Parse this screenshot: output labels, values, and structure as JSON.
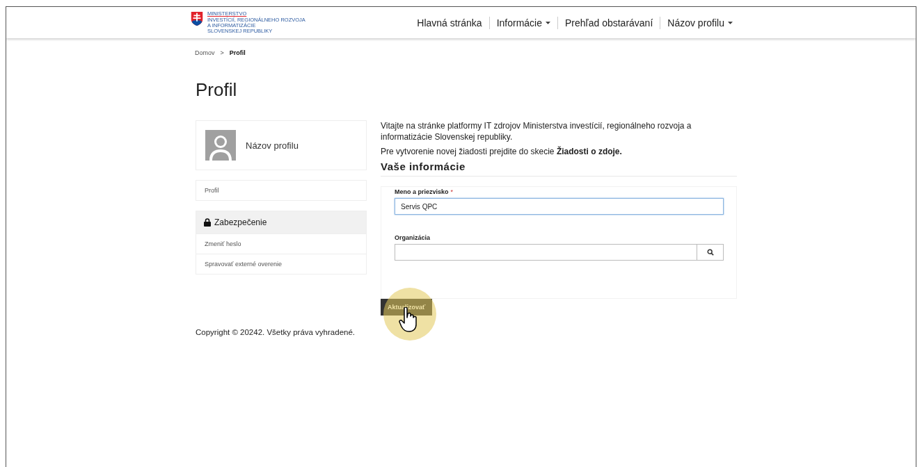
{
  "logo": {
    "lines": [
      "MINISTERSTVO",
      "INVESTÍCIÍ, REGIONÁLNEHO ROZVOJA",
      "A INFORMATIZÁCIE",
      "SLOVENSKEJ REPUBLIKY"
    ]
  },
  "nav": [
    {
      "label": "Hlavná stránka",
      "dropdown": false
    },
    {
      "label": "Informácie",
      "dropdown": true
    },
    {
      "label": "Prehľad obstarávaní",
      "dropdown": false
    },
    {
      "label": "Názov profilu",
      "dropdown": true
    }
  ],
  "breadcrumb": [
    {
      "label": "Domov",
      "selected": false
    },
    {
      "label": "Profil",
      "selected": true
    }
  ],
  "breadcrumb_separator": ">",
  "page_title": "Profil",
  "profile_card": {
    "name": "Názov profilu"
  },
  "sidebar": {
    "items": [
      {
        "label": "Profil"
      }
    ],
    "section": {
      "title": "Zabezpečenie",
      "items": [
        {
          "label": "Zmeniť heslo"
        },
        {
          "label": "Spravovať externé overenie"
        }
      ]
    }
  },
  "intro": [
    "Vitajte na stránke platformy IT zdrojov Ministerstva investícií, regionálneho rozvoja a informatizácie Slovenskej republiky.",
    "Pre vytvorenie novej žiadosti prejdite do skecie **Žiadosti o zdoje.**"
  ],
  "section_title": "Vaše informácie",
  "form": {
    "fields": [
      {
        "kind": "text",
        "label": "Meno a priezvisko",
        "required_mark": "*",
        "value": "Servis QPC",
        "focused": true
      },
      {
        "kind": "search",
        "label": "Organizácia",
        "focused": false
      }
    ]
  },
  "submit": "Aktualizovať",
  "footer": "Copyright © 20242. Všetky práva vyhradené."
}
